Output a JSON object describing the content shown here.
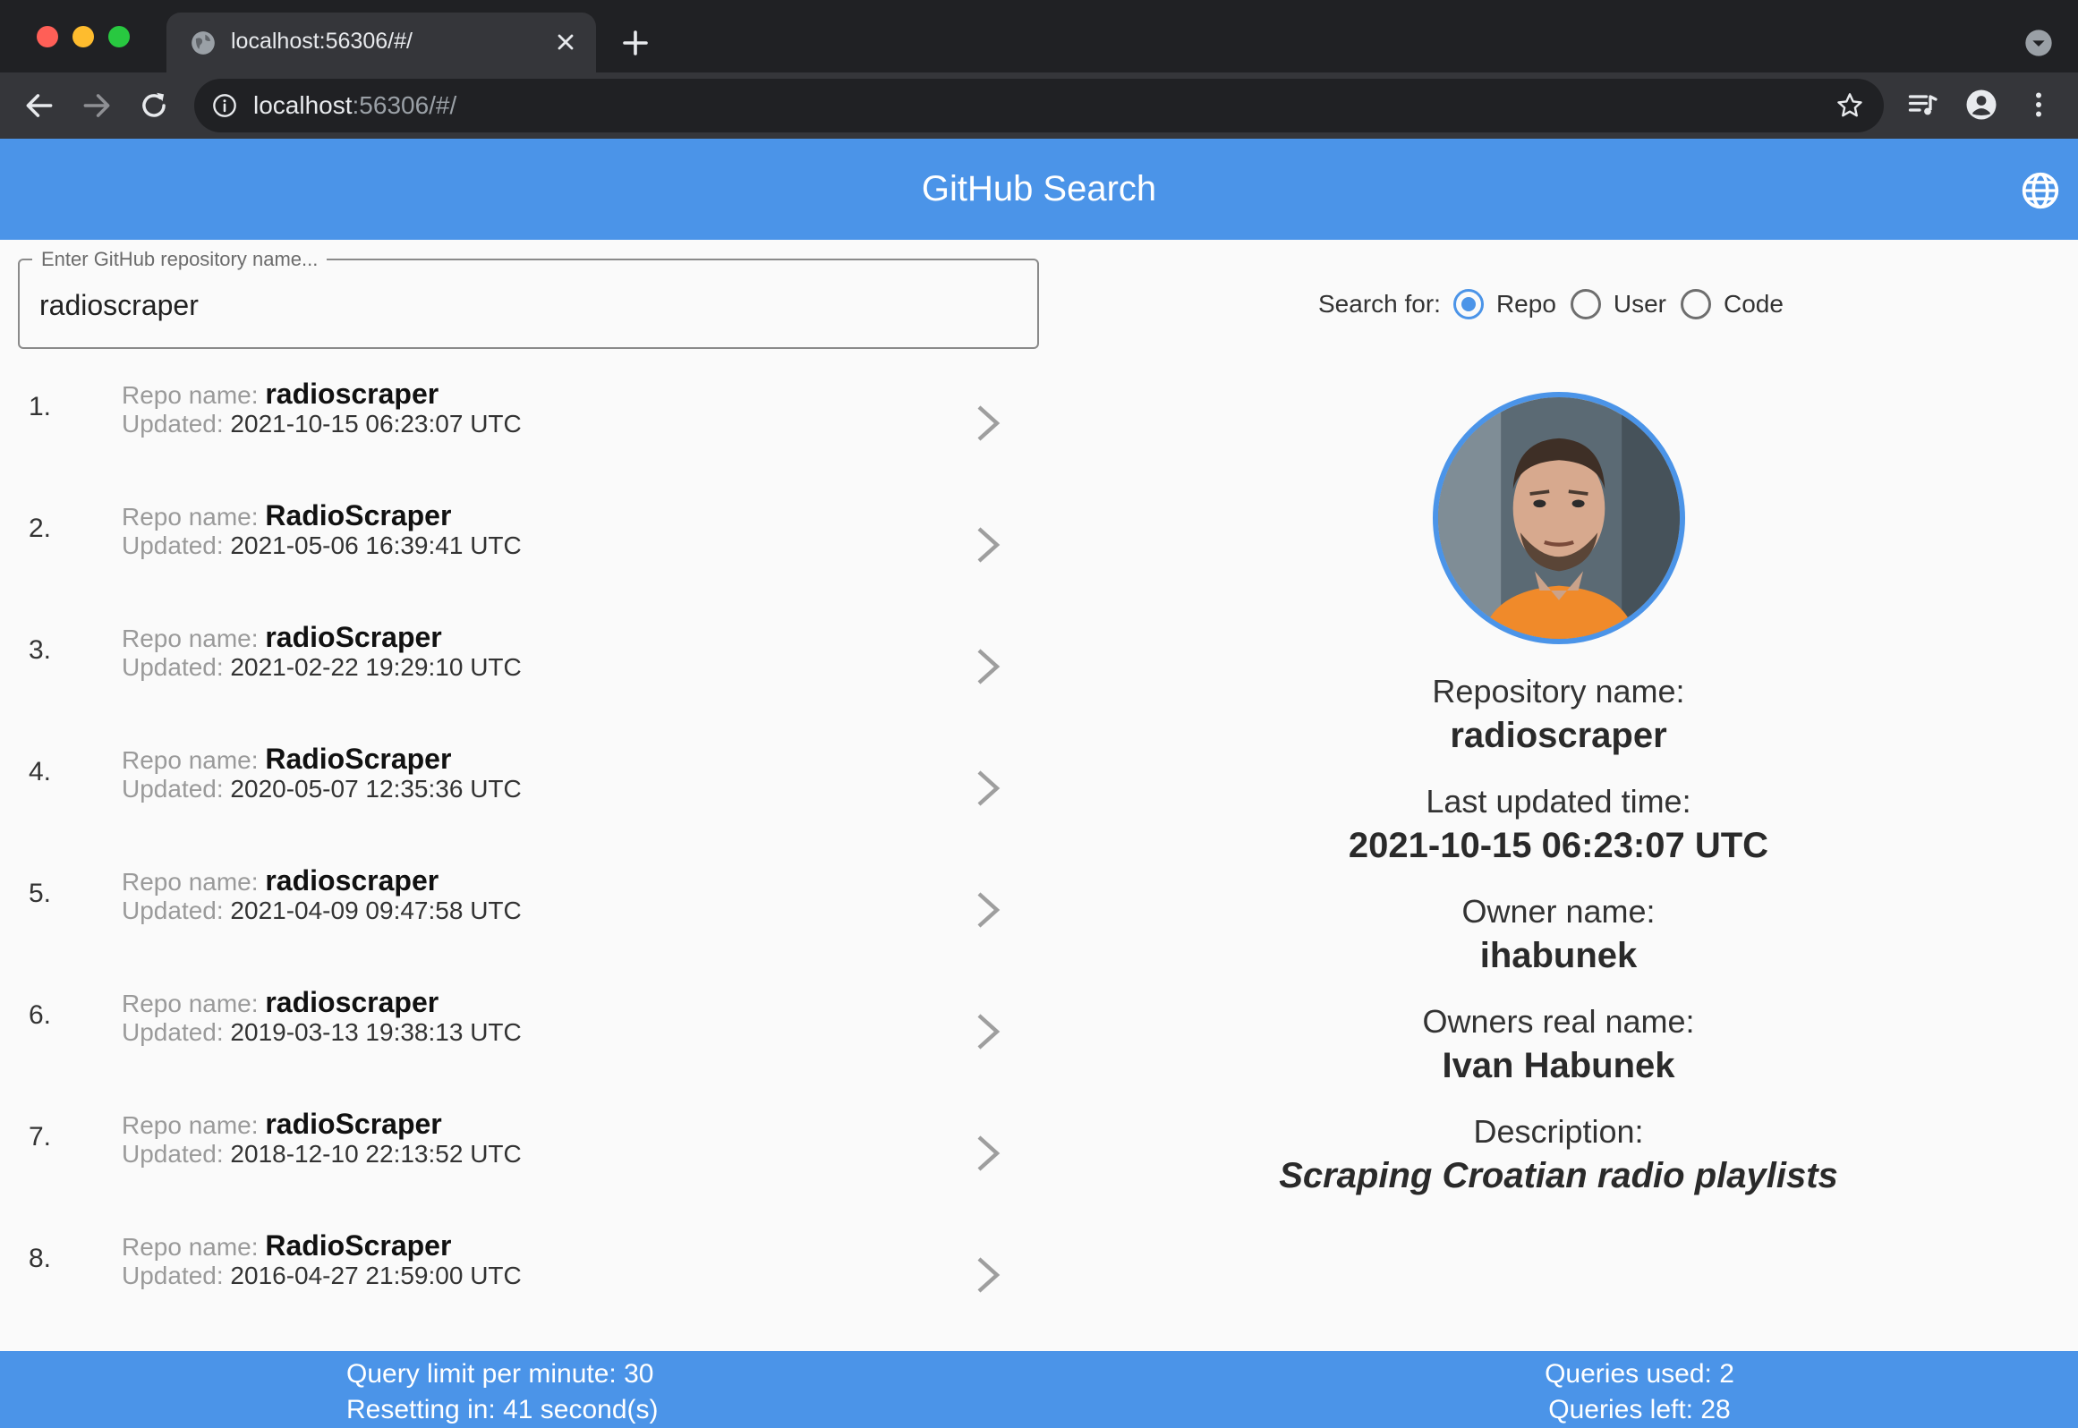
{
  "browser": {
    "tab_title": "localhost:56306/#/",
    "url_host": "localhost",
    "url_rest": ":56306/#/"
  },
  "app": {
    "title": "GitHub Search",
    "search": {
      "label": "Enter GitHub repository name...",
      "value": "radioscraper"
    },
    "search_for": {
      "label": "Search for:",
      "options": [
        "Repo",
        "User",
        "Code"
      ],
      "selected": "Repo"
    },
    "results": [
      {
        "index": "1.",
        "name_label": "Repo name:",
        "name": "radioscraper",
        "updated_label": "Updated:",
        "updated": "2021-10-15 06:23:07 UTC"
      },
      {
        "index": "2.",
        "name_label": "Repo name:",
        "name": "RadioScraper",
        "updated_label": "Updated:",
        "updated": "2021-05-06 16:39:41 UTC"
      },
      {
        "index": "3.",
        "name_label": "Repo name:",
        "name": "radioScraper",
        "updated_label": "Updated:",
        "updated": "2021-02-22 19:29:10 UTC"
      },
      {
        "index": "4.",
        "name_label": "Repo name:",
        "name": "RadioScraper",
        "updated_label": "Updated:",
        "updated": "2020-05-07 12:35:36 UTC"
      },
      {
        "index": "5.",
        "name_label": "Repo name:",
        "name": "radioscraper",
        "updated_label": "Updated:",
        "updated": "2021-04-09 09:47:58 UTC"
      },
      {
        "index": "6.",
        "name_label": "Repo name:",
        "name": "radioscraper",
        "updated_label": "Updated:",
        "updated": "2019-03-13 19:38:13 UTC"
      },
      {
        "index": "7.",
        "name_label": "Repo name:",
        "name": "radioScraper",
        "updated_label": "Updated:",
        "updated": "2018-12-10 22:13:52 UTC"
      },
      {
        "index": "8.",
        "name_label": "Repo name:",
        "name": "RadioScraper",
        "updated_label": "Updated:",
        "updated": "2016-04-27 21:59:00 UTC"
      }
    ],
    "details": {
      "repo_name_label": "Repository name:",
      "repo_name": "radioscraper",
      "updated_label": "Last updated time:",
      "updated": "2021-10-15 06:23:07 UTC",
      "owner_label": "Owner name:",
      "owner": "ihabunek",
      "real_name_label": "Owners real name:",
      "real_name": "Ivan Habunek",
      "description_label": "Description:",
      "description": "Scraping Croatian radio playlists"
    },
    "footer": {
      "query_limit": "Query limit per minute: 30",
      "resetting": "Resetting in: 41 second(s)",
      "queries_used": "Queries used: 2",
      "queries_left": "Queries left: 28"
    }
  },
  "colors": {
    "accent": "#4b94e8",
    "chrome_dark": "#202124",
    "chrome_toolbar": "#35363a"
  },
  "icons": [
    "globe-icon",
    "chevron-right-icon",
    "back-arrow-icon",
    "forward-arrow-icon",
    "reload-icon",
    "info-icon",
    "star-icon",
    "media-icon",
    "profile-icon",
    "menu-icon",
    "close-icon",
    "plus-icon"
  ]
}
